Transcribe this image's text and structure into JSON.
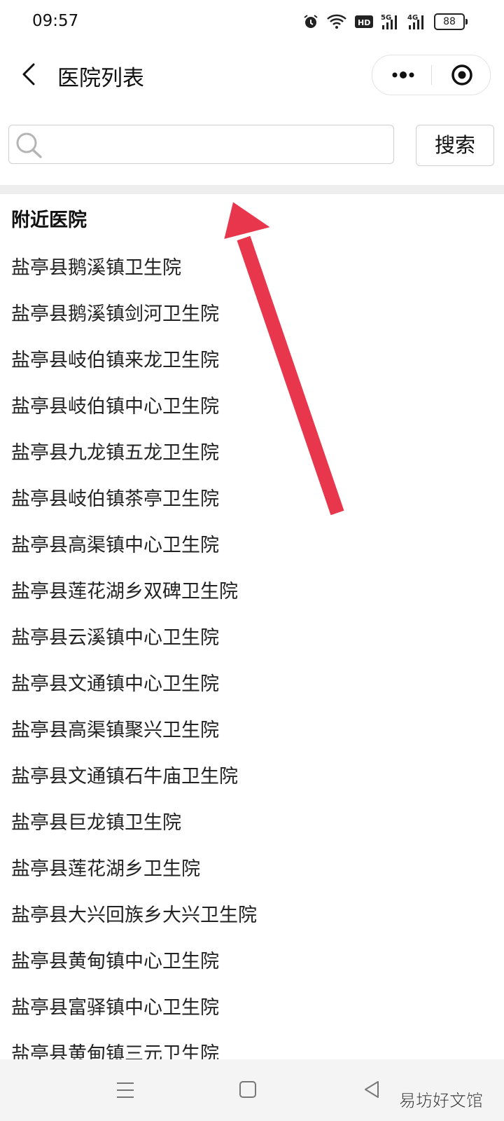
{
  "status_bar": {
    "time": "09:57",
    "battery": "88",
    "net_5g": "5G",
    "net_4g": "4G",
    "hd": "HD"
  },
  "nav": {
    "title": "医院列表"
  },
  "search": {
    "placeholder": "",
    "value": "",
    "button_label": "搜索"
  },
  "section": {
    "title": "附近医院"
  },
  "hospitals": [
    "盐亭县鹅溪镇卫生院",
    "盐亭县鹅溪镇剑河卫生院",
    "盐亭县岐伯镇来龙卫生院",
    "盐亭县岐伯镇中心卫生院",
    "盐亭县九龙镇五龙卫生院",
    "盐亭县岐伯镇茶亭卫生院",
    "盐亭县高渠镇中心卫生院",
    "盐亭县莲花湖乡双碑卫生院",
    "盐亭县云溪镇中心卫生院",
    "盐亭县文通镇中心卫生院",
    "盐亭县高渠镇聚兴卫生院",
    "盐亭县文通镇石牛庙卫生院",
    "盐亭县巨龙镇卫生院",
    "盐亭县莲花湖乡卫生院",
    "盐亭县大兴回族乡大兴卫生院",
    "盐亭县黄甸镇中心卫生院",
    "盐亭县富驿镇中心卫生院",
    "盐亭县黄甸镇三元卫生院"
  ],
  "watermark": "易坊好文馆",
  "colors": {
    "arrow": "#e8364c",
    "divider": "#eeeeee"
  }
}
